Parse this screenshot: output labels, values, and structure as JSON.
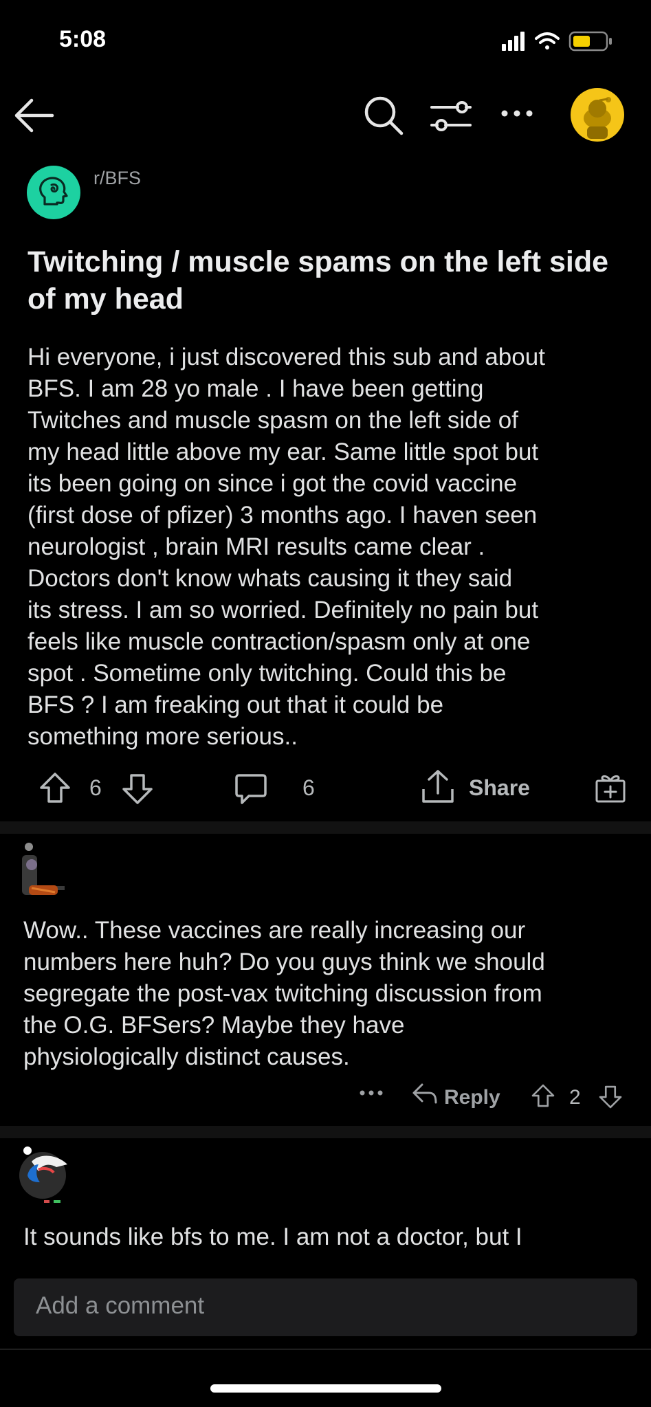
{
  "status_bar": {
    "time": "5:08"
  },
  "subreddit": {
    "name": "r/BFS"
  },
  "post": {
    "title": "Twitching / muscle spams on the left side of my head",
    "body": "Hi everyone, i just discovered this sub and about\nBFS. I am 28 yo male . I have been getting\nTwitches and muscle spasm on the left side of\nmy head little above my ear. Same little spot but\nits been going on since i got the covid vaccine\n(first dose of pfizer)  3 months ago. I haven seen\nneurologist , brain MRI results came clear .\nDoctors don't know whats causing it  they said\nits stress. I am so worried. Definitely no pain but\nfeels like muscle contraction/spasm only at one\nspot . Sometime only twitching. Could this be\nBFS ? I am freaking out that it could be\nsomething more serious..",
    "votes": "6",
    "comments": "6",
    "share_label": "Share"
  },
  "comments": [
    {
      "body": "Wow.. These vaccines are really increasing our\nnumbers here huh?  Do you guys think we should\nsegregate the post-vax twitching discussion from\nthe O.G. BFSers?  Maybe they have\nphysiologically distinct causes.",
      "reply_label": "Reply",
      "votes": "2"
    },
    {
      "body": "It sounds like bfs to me. I am not a doctor, but I"
    }
  ],
  "composer": {
    "placeholder": "Add a comment"
  },
  "colors": {
    "background": "#000000",
    "accent_avatar": "#f5c518",
    "subreddit_icon": "#1dd1a1"
  }
}
